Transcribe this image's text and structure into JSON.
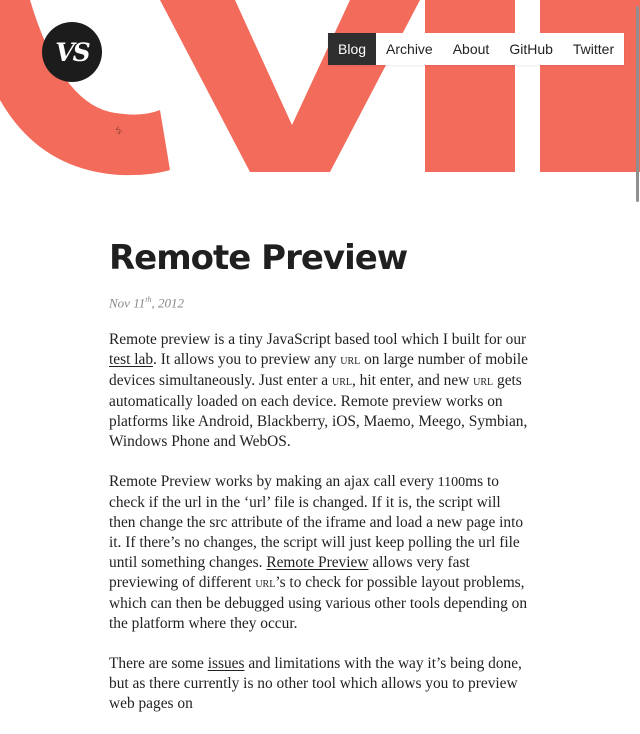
{
  "colors": {
    "accent": "#f26b5b",
    "nav_active_bg": "#2f2f2f",
    "logo_bg": "#1c1c1c"
  },
  "hero": {
    "background_text": "evil"
  },
  "logo": {
    "text": "VS"
  },
  "nav": {
    "items": [
      {
        "label": "Blog",
        "active": true
      },
      {
        "label": "Archive"
      },
      {
        "label": "About"
      },
      {
        "label": "GitHub"
      },
      {
        "label": "Twitter"
      }
    ]
  },
  "post": {
    "title": "Remote Preview",
    "date": {
      "month": "Nov",
      "day": "11",
      "suffix": "th",
      "year": "2012"
    },
    "p1": {
      "t1": "Remote preview is a tiny JavaScript based tool which I built for our ",
      "link_test_lab": "test lab",
      "t2": ". It allows you to preview any ",
      "url1": "url",
      "t3": " on large number of mobile devices simultaneously. Just enter a ",
      "url2": "url",
      "t4": ", hit enter, and new ",
      "url3": "url",
      "t5": " gets automatically loaded on each device. Remote preview works on platforms like Android, Blackberry, iOS, Maemo, Meego, Symbian, Windows Phone and WebOS."
    },
    "p2": {
      "t1": "Remote Preview works by making an ajax call every ",
      "num": "1100",
      "t2": "ms to check if the url in the ‘url’ file is changed. If it is, the script will then change the src attribute of the iframe and load a new page into it. If there’s no changes, the script will just keep polling the url file until something changes. ",
      "link_remote_preview": "Remote Preview",
      "t3": " allows very fast previewing of different ",
      "url": "url",
      "t4": "’s to check for possible layout problems, which can then be debugged using various other tools depending on the platform where they occur."
    },
    "p3": {
      "t1": "There are some ",
      "link_issues": "issues",
      "t2": " and limitations with the way it’s being done, but as there currently is no other tool which allows you to preview web pages on"
    }
  }
}
